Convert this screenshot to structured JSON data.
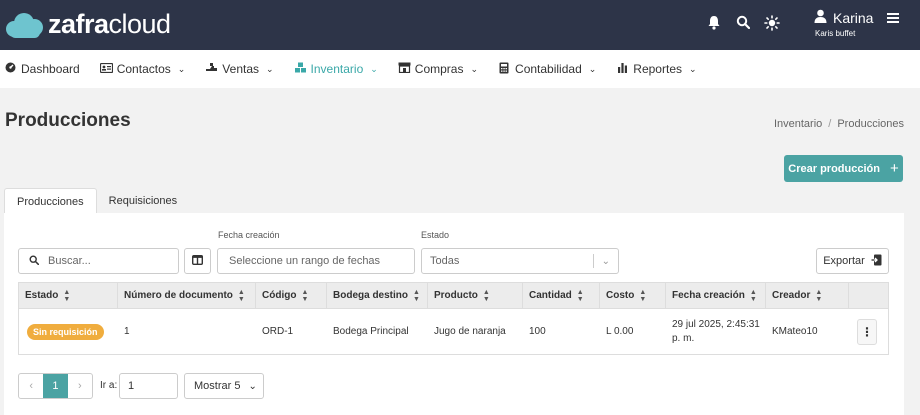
{
  "brand": {
    "part1": "zafra",
    "part2": "cloud"
  },
  "topbar": {
    "user_name": "Karina",
    "user_company": "Karis buffet"
  },
  "nav": [
    {
      "label": "Dashboard",
      "icon": "dashboard-icon",
      "has_menu": false
    },
    {
      "label": "Contactos",
      "icon": "contacts-icon",
      "has_menu": true
    },
    {
      "label": "Ventas",
      "icon": "sales-icon",
      "has_menu": true
    },
    {
      "label": "Inventario",
      "icon": "inventory-icon",
      "has_menu": true,
      "active": true
    },
    {
      "label": "Compras",
      "icon": "store-icon",
      "has_menu": true
    },
    {
      "label": "Contabilidad",
      "icon": "calculator-icon",
      "has_menu": true
    },
    {
      "label": "Reportes",
      "icon": "bar-chart-icon",
      "has_menu": true
    }
  ],
  "page": {
    "title": "Producciones",
    "breadcrumb": [
      "Inventario",
      "Producciones"
    ],
    "create_button": "Crear producción"
  },
  "tabs": [
    "Producciones",
    "Requisiciones"
  ],
  "filters": {
    "search_placeholder": "Buscar...",
    "date_label": "Fecha creación",
    "date_placeholder": "Seleccione un rango de fechas",
    "estado_label": "Estado",
    "estado_value": "Todas",
    "export_label": "Exportar"
  },
  "table": {
    "columns": [
      "Estado",
      "Número de documento",
      "Código",
      "Bodega destino",
      "Producto",
      "Cantidad",
      "Costo",
      "Fecha creación",
      "Creador"
    ],
    "rows": [
      {
        "estado": "Sin requisición",
        "numero": "1",
        "codigo": "ORD-1",
        "bodega": "Bodega Principal",
        "producto": "Jugo de naranja",
        "cantidad": "100",
        "costo": "L 0.00",
        "fecha": "29 jul 2025, 2:45:31 p. m.",
        "creador": "KMateo10"
      }
    ]
  },
  "pagination": {
    "current_page": "1",
    "goto_label": "Ir a:",
    "goto_value": "1",
    "page_size_label": "Mostrar 5"
  },
  "colors": {
    "topbar": "#2d3448",
    "accent": "#4ba3a3",
    "badge": "#f0ad3e"
  }
}
